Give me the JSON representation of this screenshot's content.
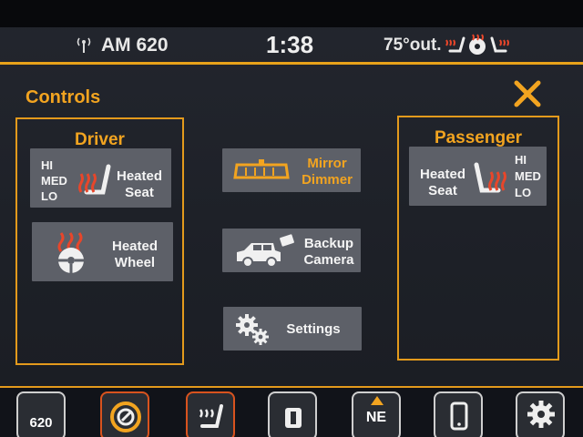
{
  "status": {
    "radio": "AM 620",
    "time": "1:38",
    "temperature": "75°out."
  },
  "screen": {
    "title": "Controls"
  },
  "driver": {
    "title": "Driver",
    "heated_seat": {
      "levels": [
        "HI",
        "MED",
        "LO"
      ],
      "label_line1": "Heated",
      "label_line2": "Seat"
    },
    "heated_wheel": {
      "label_line1": "Heated",
      "label_line2": "Wheel"
    }
  },
  "center": {
    "mirror": {
      "label_line1": "Mirror",
      "label_line2": "Dimmer"
    },
    "camera": {
      "label_line1": "Backup",
      "label_line2": "Camera"
    },
    "settings": {
      "label": "Settings"
    }
  },
  "passenger": {
    "title": "Passenger",
    "heated_seat": {
      "levels": [
        "HI",
        "MED",
        "LO"
      ],
      "label_line1": "Heated",
      "label_line2": "Seat"
    }
  },
  "dock": {
    "radio_label": "620",
    "nav_label": "NE"
  },
  "colors": {
    "accent": "#e8a21a",
    "heat": "#e8462a",
    "tile": "#5d6068"
  }
}
